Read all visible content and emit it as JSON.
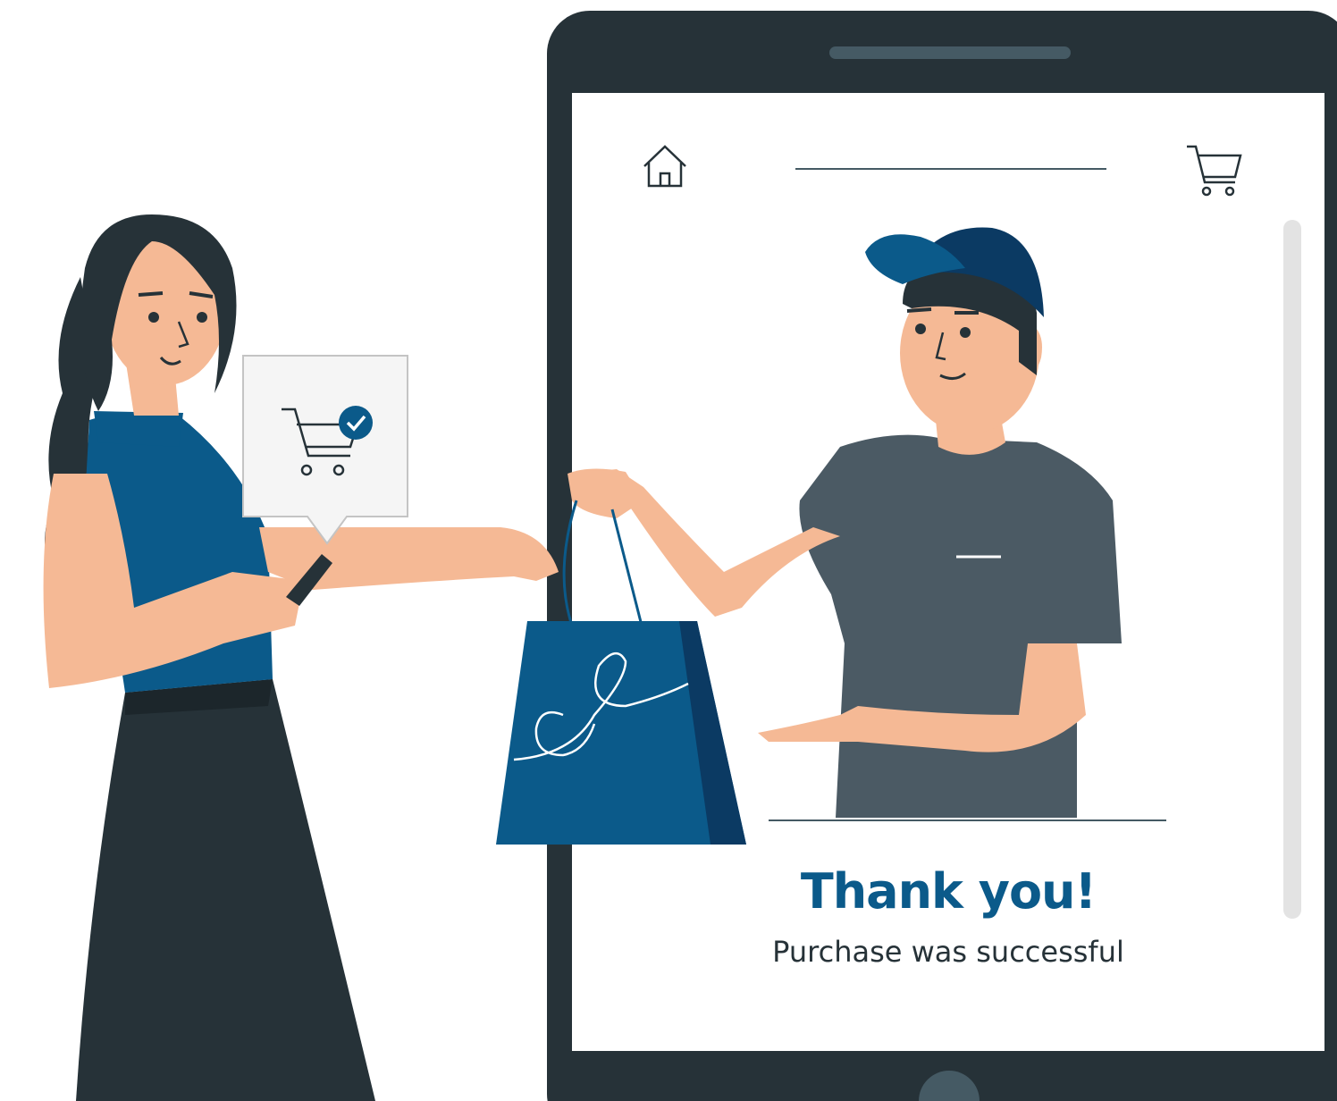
{
  "screen": {
    "title": "Thank you!",
    "subtitle": "Purchase was successful"
  },
  "icons": {
    "home": "home-icon",
    "cart": "cart-icon",
    "popup_cart": "cart-check-icon"
  },
  "colors": {
    "brand_blue": "#0b5a8a",
    "dark": "#263238",
    "shirt_gray": "#4b5a64",
    "skin": "#f5b995"
  }
}
